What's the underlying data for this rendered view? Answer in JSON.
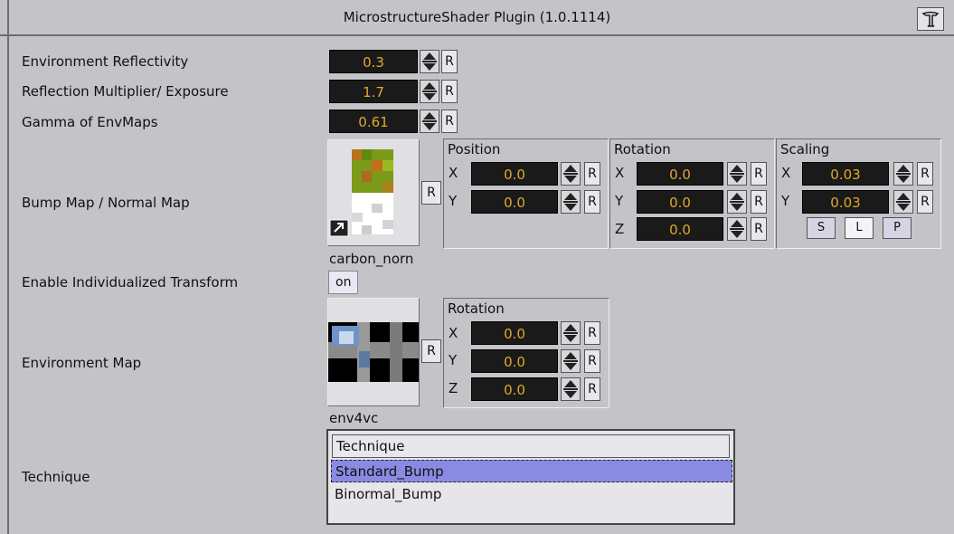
{
  "window": {
    "title": "MicrostructureShader Plugin (1.0.1114)",
    "menu_icon": "plugin-menu-icon"
  },
  "labels": {
    "env_reflectivity": "Environment Reflectivity",
    "reflection_multiplier": "Reflection Multiplier/ Exposure",
    "gamma": "Gamma of EnvMaps",
    "bump_map": "Bump Map / Normal Map",
    "enable_transform": "Enable Individualized Transform",
    "env_map": "Environment Map",
    "technique": "Technique"
  },
  "values": {
    "env_reflectivity": "0.3",
    "reflection_multiplier": "1.7",
    "gamma": "0.61"
  },
  "reset_label": "R",
  "bump": {
    "texture_name": "carbon_norn",
    "position": {
      "title": "Position",
      "x": "0.0",
      "y": "0.0"
    },
    "rotation": {
      "title": "Rotation",
      "x": "0.0",
      "y": "0.0",
      "z": "0.0"
    },
    "scaling": {
      "title": "Scaling",
      "x": "0.03",
      "y": "0.03"
    },
    "scale_modes": [
      "S",
      "L",
      "P"
    ],
    "active_scale_mode": "L"
  },
  "axes": {
    "x": "X",
    "y": "Y",
    "z": "Z"
  },
  "enable_transform_value": "on",
  "envmap": {
    "texture_name": "env4vc",
    "rotation": {
      "title": "Rotation",
      "x": "0.0",
      "y": "0.0",
      "z": "0.0"
    }
  },
  "technique": {
    "header": "Technique",
    "items": [
      "Standard_Bump",
      "Binormal_Bump"
    ],
    "selected": "Standard_Bump"
  },
  "colors": {
    "field_bg": "#1a1a1a",
    "field_text": "#e3a82a",
    "selection": "#8a8ae2",
    "panel": "#c4c4c8"
  }
}
